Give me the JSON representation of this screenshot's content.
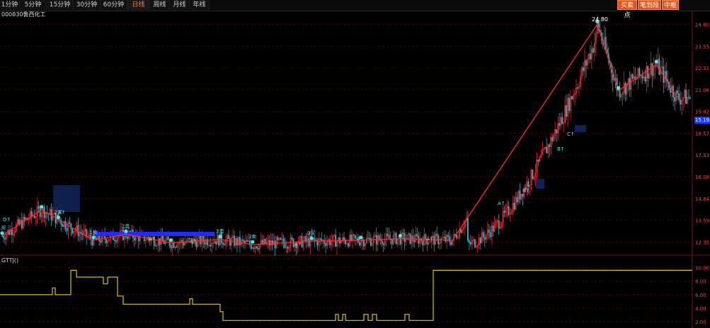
{
  "tabs": [
    {
      "label": "1分钟",
      "active": false
    },
    {
      "label": "5分钟",
      "active": false
    },
    {
      "label": "15分钟",
      "active": false
    },
    {
      "label": "30分钟",
      "active": false
    },
    {
      "label": "60分钟",
      "active": false
    },
    {
      "label": "日线",
      "active": true
    },
    {
      "label": "周线",
      "active": false
    },
    {
      "label": "月线",
      "active": false
    },
    {
      "label": "年线",
      "active": false
    }
  ],
  "right_buttons": [
    {
      "label": "买卖点"
    },
    {
      "label": "笔划段"
    },
    {
      "label": "中枢"
    }
  ],
  "stock_title": "000830鲁西化工",
  "indicator_name": "GTTJ()",
  "current_price": "15.19",
  "peak_label": "24.80",
  "colors": {
    "background": "#000000",
    "grid": "#4a0a0a",
    "zigzag": "#ff2a2a",
    "bull_candle": "#ff3030",
    "bear_candle": "#39b9d6",
    "signal": "#4fe7e7",
    "indicator_line": "#d9c400",
    "active_tab": "#ff7a2a",
    "button_bg": "#e0561e"
  },
  "chart_data": {
    "type": "line",
    "title": "000830鲁西化工",
    "zigzag_points": [
      {
        "bar": 0,
        "price": 12.7
      },
      {
        "bar": 28,
        "price": 14.2
      },
      {
        "bar": 65,
        "price": 12.45
      },
      {
        "bar": 88,
        "price": 12.8
      },
      {
        "bar": 120,
        "price": 12.3
      },
      {
        "bar": 155,
        "price": 12.5
      },
      {
        "bar": 178,
        "price": 12.2
      },
      {
        "bar": 220,
        "price": 12.4
      },
      {
        "bar": 255,
        "price": 12.45
      },
      {
        "bar": 283,
        "price": 12.55
      },
      {
        "bar": 320,
        "price": 12.45
      },
      {
        "bar": 423,
        "price": 24.8
      },
      {
        "bar": 438,
        "price": 21.0
      },
      {
        "bar": 465,
        "price": 22.5
      },
      {
        "bar": 480,
        "price": 20.6
      }
    ],
    "y_axis_ticks": [
      "24.80",
      "23.55",
      "22.31",
      "21.06",
      "19.82",
      "18.57",
      "17.33",
      "16.08",
      "14.84",
      "13.59",
      "12.35"
    ],
    "signals": [
      "1买",
      "2买",
      "2卖",
      "3卖",
      "3买",
      "1卖",
      "1类",
      "A",
      "B",
      "C"
    ],
    "indicator_levels": [
      "10.00",
      "8.00",
      "6.00",
      "4.00",
      "2.00"
    ]
  }
}
